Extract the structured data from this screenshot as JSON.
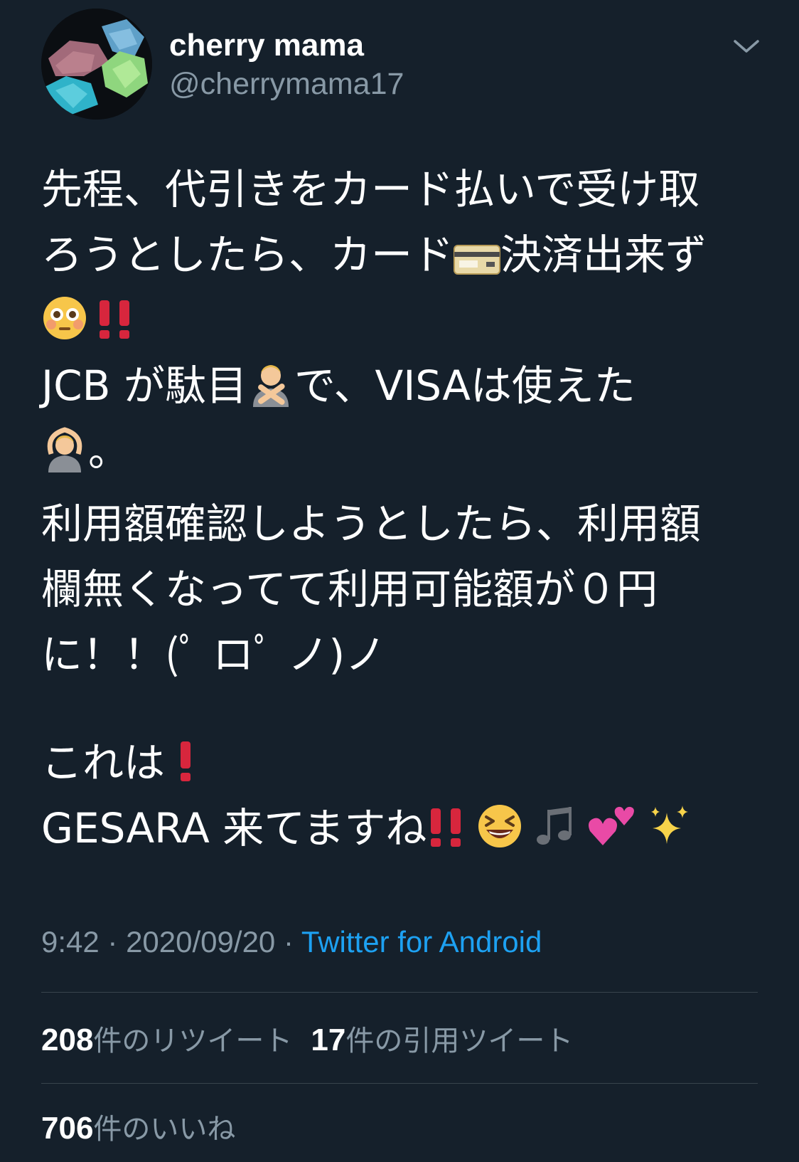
{
  "author": {
    "name": "cherry mama",
    "handle": "@cherrymama17",
    "avatar_icon": "gemstones-avatar"
  },
  "tweet": {
    "lines": {
      "l1": "先程、代引きをカード払いで受け取",
      "l2a": "ろうとしたら、カード",
      "l2b": "決済出来ず",
      "l4a": "JCB が駄目",
      "l4b": "で、VISAは使えた",
      "l5": "。",
      "l6": "利用額確認しようとしたら、利用額",
      "l7": "欄無くなってて利用可能額が０円",
      "l8": "に！！(ﾟ ロﾟ ノ)ノ",
      "l9": "これは",
      "l10": "GESARA 来てますね"
    },
    "emoji": {
      "credit_card": "credit-card-icon",
      "flushed": "flushed-face-icon",
      "double_exclamation": "double-exclamation-icon",
      "no_gesture": "person-gesturing-no-icon",
      "ok_gesture": "person-gesturing-ok-icon",
      "exclamation": "exclamation-icon",
      "laughing": "grinning-squinting-face-icon",
      "notes": "musical-notes-icon",
      "hearts": "two-hearts-icon",
      "sparkles": "sparkles-icon"
    }
  },
  "meta": {
    "time": "9:42",
    "date": "2020/09/20",
    "separator": " · ",
    "source": "Twitter for Android"
  },
  "stats": {
    "retweets_count": "208",
    "retweets_label": "件のリツイート",
    "quotes_count": "17",
    "quotes_label": "件の引用ツイート",
    "likes_count": "706",
    "likes_label": "件のいいね"
  },
  "colors": {
    "background": "#15202b",
    "secondary_text": "#8899a6",
    "link": "#1da1f2",
    "divider": "#38444d"
  }
}
